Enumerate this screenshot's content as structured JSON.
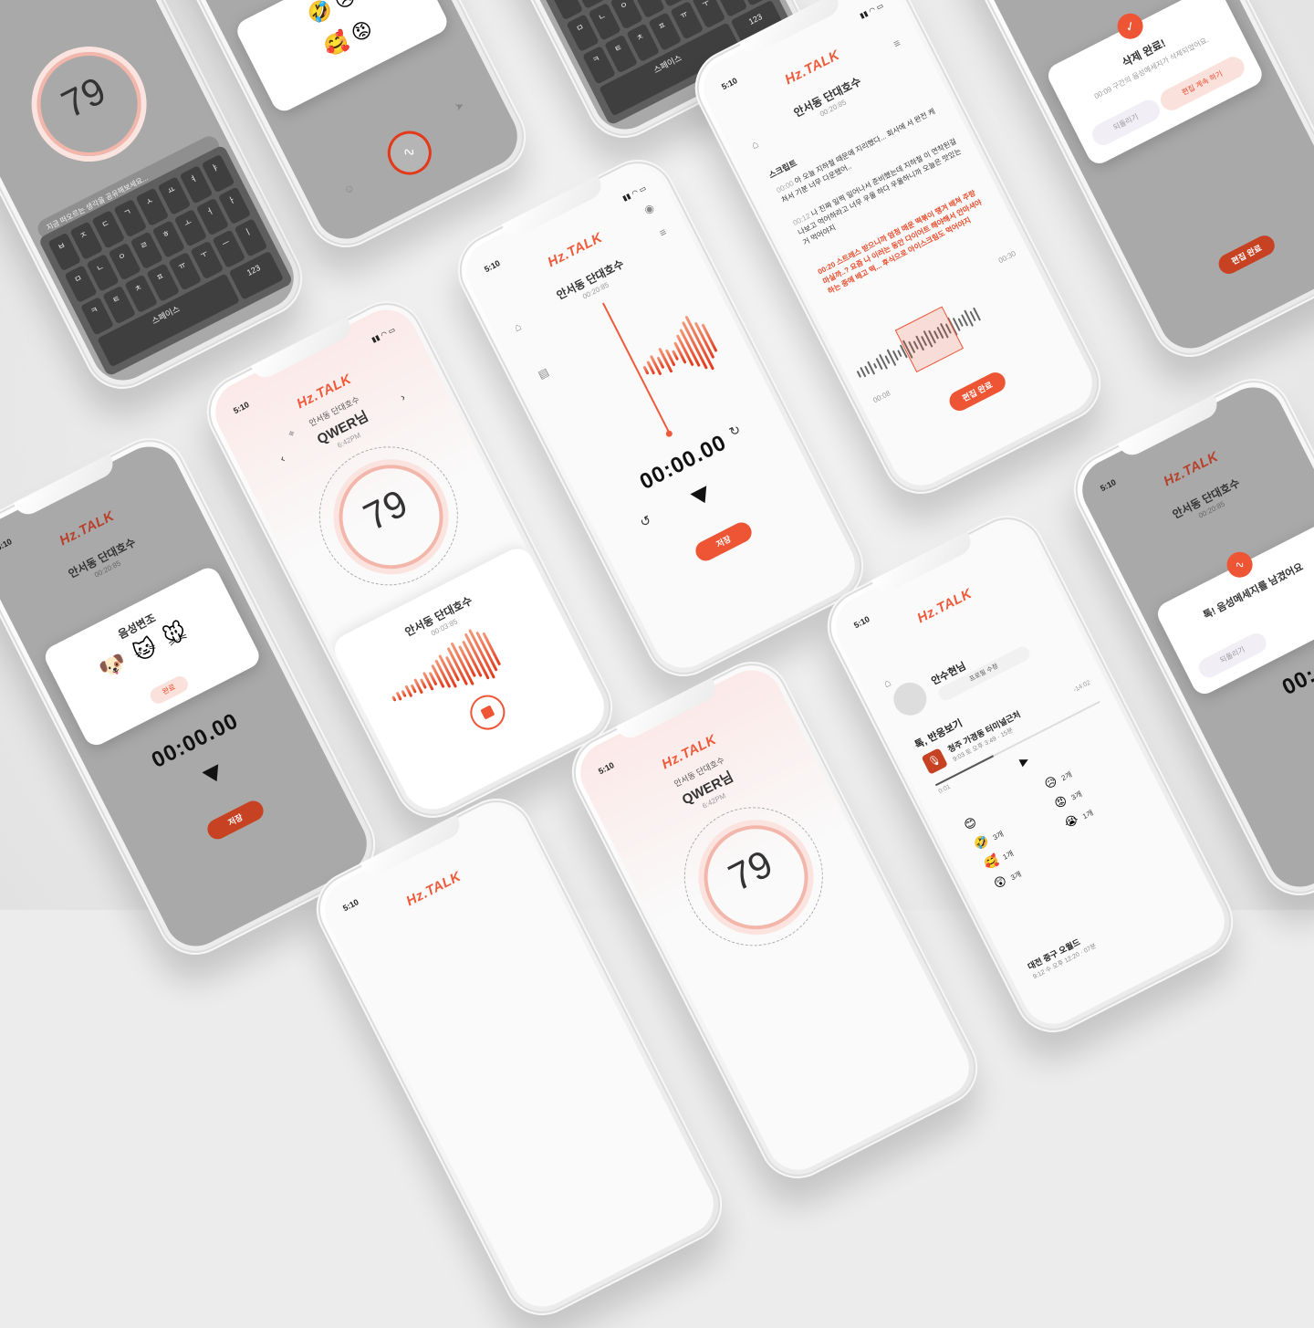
{
  "app": {
    "logo": "Hz.TALK",
    "status_time": "5:10"
  },
  "recorder": {
    "place": "안서동 단대호수",
    "elapsed": "00:20:85",
    "timer": "00:00.00",
    "save_label": "저장"
  },
  "live": {
    "place": "안서동 단대호수",
    "user": "QWER님",
    "clock": "6:42PM",
    "level": "79",
    "clip_time": "00:03:85"
  },
  "script": {
    "place": "안서동 단대호수",
    "elapsed": "00:20:85",
    "section": "스크립트",
    "lines": [
      {
        "time": "00:00",
        "text": "아 오늘 지하철 때문에 지리했다... 회사에 서 완전 케쳐서 기분 너무 다운됐어.."
      },
      {
        "time": "00:12",
        "text": "나 진짜 일찍 일어나서 준비했는데 지하철 이 연착된걸 나보고 억어하라고 너무 우울 하다 우울하니까 오늘은 맛있는거 먹어야지"
      },
      {
        "time": "00:20",
        "text": "스트레스 받으니까 엄청 매운 떡볶이 땡겨 배쳐 주랑 마실까..? 요즘 나 이러는 동안 다이어트 해야해서 안마셔야하는 중에 배고 떡... 후식으로 아이스크림도 먹어야지"
      }
    ],
    "range_start": "00:08",
    "range_end": "00:30",
    "done_label": "편집 완료"
  },
  "delete_modal": {
    "title": "삭제 완료!",
    "message": "00:09 구간의 음성메세지가 삭제되었어요.",
    "undo_label": "되돌리기",
    "continue_label": "편집 계속 하기"
  },
  "voice_modal": {
    "title": "음성변조",
    "done_label": "완료"
  },
  "share_modal": {
    "title": "톡! 음성메세지를 남겼어요",
    "undo_label": "되돌리기",
    "timer": "00:"
  },
  "keyboard": {
    "prompt": "지금 떠오르는 생각을 공유해보세요...",
    "keys": [
      "ㅂ",
      "ㅈ",
      "ㄷ",
      "ㄱ",
      "ㅅ",
      "ㅛ",
      "ㅕ",
      "ㅑ",
      "ㅁ",
      "ㄴ",
      "ㅇ",
      "ㄹ",
      "ㅎ",
      "ㅗ",
      "ㅓ",
      "ㅏ",
      "ㅋ",
      "ㅌ",
      "ㅊ",
      "ㅍ",
      "ㅠ",
      "ㅜ",
      "ㅡ",
      "ㅣ"
    ],
    "space": "스페이스",
    "num": "123"
  },
  "profile": {
    "name": "안수현님",
    "edit_label": "프로필 수정",
    "section": "톡, 반응보기",
    "item_title": "청주 가경동 터미널근처",
    "item_meta": "9:03 토 오후 3:49 · 15분",
    "stats_a": "11",
    "stats_b": "8",
    "remaining": "-14:02",
    "played": "0:01",
    "reactions": [
      {
        "emoji": "😊",
        "count": ""
      },
      {
        "emoji": "😥",
        "count": "2개"
      },
      {
        "emoji": "🤣",
        "count": "3개"
      },
      {
        "emoji": "😡",
        "count": "3개"
      },
      {
        "emoji": "🥰",
        "count": "1개"
      },
      {
        "emoji": "😭",
        "count": "1개"
      },
      {
        "emoji": "😲",
        "count": "3개"
      }
    ],
    "next_title": "대전 중구 오월드",
    "next_meta": "9:12 수 오후 12:20 · 07분",
    "next_stats_a": "7",
    "next_stats_b": "15"
  },
  "colors": {
    "accent": "#ee5535",
    "accent_dark": "#c74223",
    "background": "#ececec"
  }
}
